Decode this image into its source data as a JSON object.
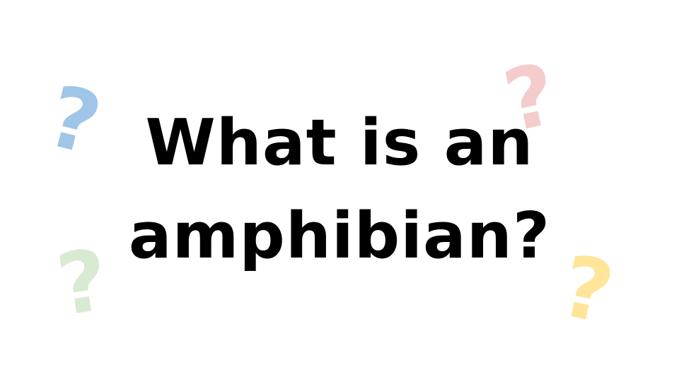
{
  "slide": {
    "title_line_1": "What is an",
    "title_line_2": "amphibian?"
  },
  "decorations": {
    "question_marks": [
      {
        "glyph": "?",
        "color": "#9fc5e8",
        "name": "blue"
      },
      {
        "glyph": "?",
        "color": "#f4cccc",
        "name": "pink"
      },
      {
        "glyph": "?",
        "color": "#d9ead3",
        "name": "green"
      },
      {
        "glyph": "?",
        "color": "#ffe599",
        "name": "yellow"
      }
    ]
  }
}
